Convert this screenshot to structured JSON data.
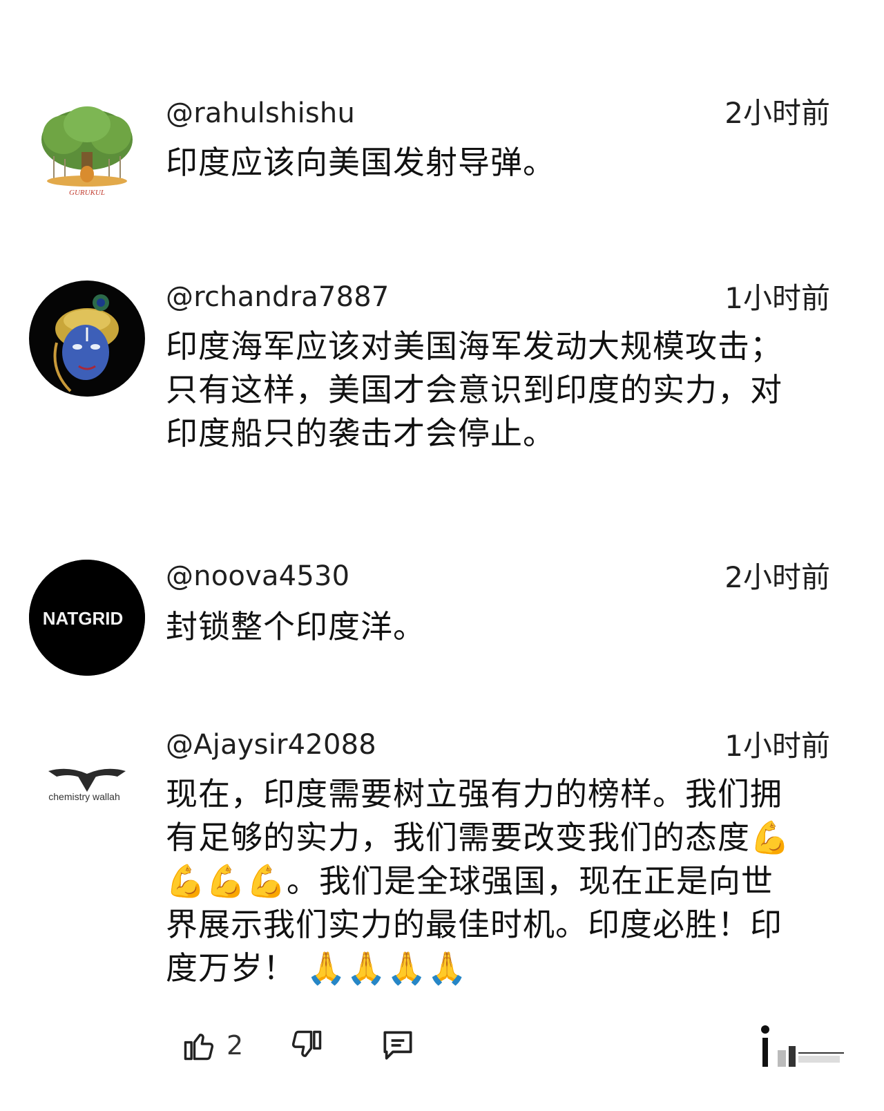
{
  "comments": [
    {
      "handle": "@rahulshishu",
      "time": "2小时前",
      "lines": [
        "印度应该向美国发射导弹。"
      ],
      "avatar": {
        "icon": "banyan-tree-icon",
        "caption": "GURUKUL"
      }
    },
    {
      "handle": "@rchandra7887",
      "time": "1小时前",
      "lines": [
        "印度海军应该对美国海军发动大规模攻击；",
        "只有这样，美国才会意识到印度的实力，对",
        "印度船只的袭击才会停止。"
      ],
      "avatar": {
        "icon": "krishna-portrait-icon"
      }
    },
    {
      "handle": "@noova4530",
      "time": "2小时前",
      "lines": [
        "封锁整个印度洋。"
      ],
      "avatar": {
        "icon": "natgrid-logo-icon",
        "text": "NATGRID"
      }
    },
    {
      "handle": "@Ajaysir42088",
      "time": "1小时前",
      "lines": [
        "现在，印度需要树立强有力的榜样。我们拥",
        "有足够的实力，我们需要改变我们的态度",
        "。我们是全球强国，现在正是向世",
        "界展示我们实力的最佳时机。印度必胜！印",
        "度万岁！"
      ],
      "emoji": {
        "flexed_biceps": "💪",
        "folded_hands": "🙏"
      },
      "avatar": {
        "icon": "chemistry-wallah-logo-icon",
        "text": "chemistry wallah"
      }
    }
  ],
  "actions": {
    "like_count": "2",
    "icons": [
      "thumbs-up-icon",
      "thumbs-down-icon",
      "reply-icon",
      "more-icon"
    ]
  },
  "colors": {
    "text": "#111111",
    "emoji": "#f2b21b",
    "natgrid_bg": "#000000",
    "krishna_skin": "#3d5fb8"
  }
}
